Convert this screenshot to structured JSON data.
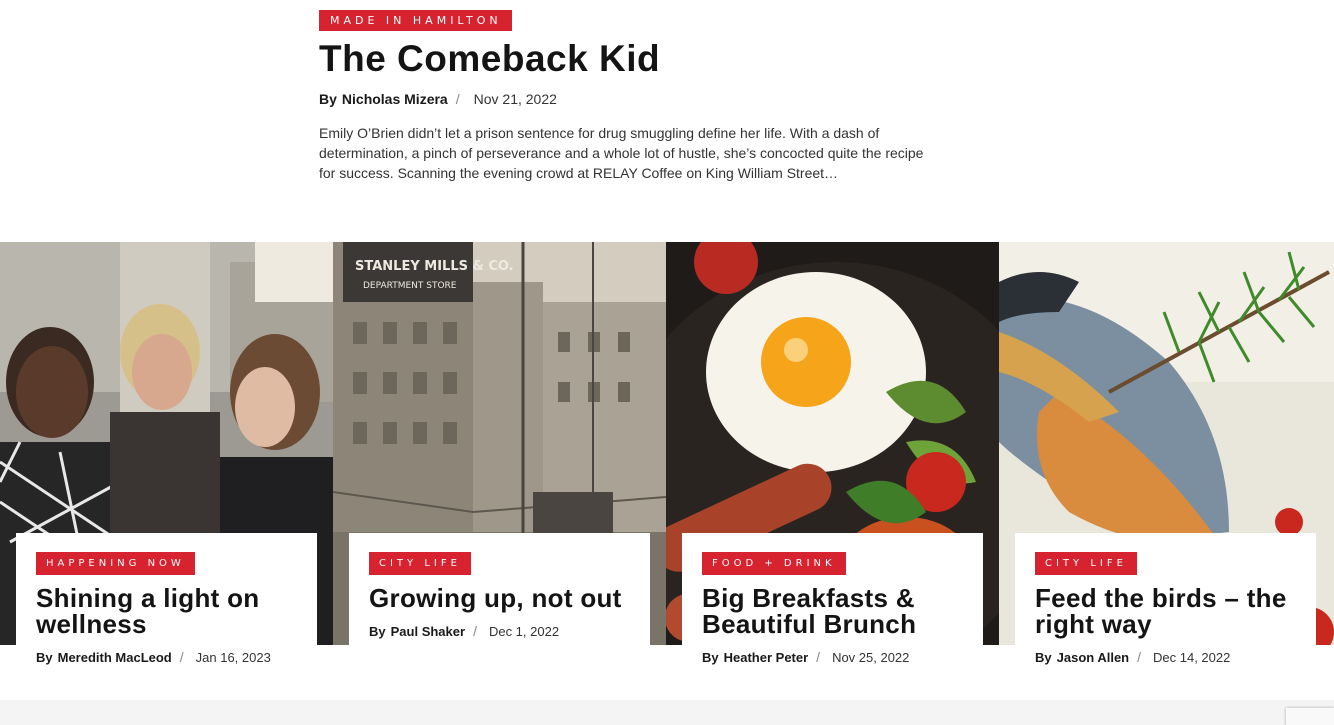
{
  "featured": {
    "tag": "Made in Hamilton",
    "title": "The Comeback Kid",
    "by": "By",
    "author": "Nicholas Mizera",
    "date": "Nov 21, 2022",
    "excerpt": "Emily O’Brien didn’t let a prison sentence for drug smuggling define her life. With a dash of determination, a pinch of perseverance and a whole lot of hustle, she’s concocted quite the recipe for success. Scanning the evening crowd at RELAY Coffee on King William Street…"
  },
  "cards": [
    {
      "tag": "Happening Now",
      "title": "Shining a light on wellness",
      "by": "By",
      "author": "Meredith MacLeod",
      "date": "Jan 16, 2023",
      "image": "photo-women-smiling"
    },
    {
      "tag": "City Life",
      "title": "Growing up, not out",
      "by": "By",
      "author": "Paul Shaker",
      "date": "Dec 1, 2022",
      "image": "photo-historic-street"
    },
    {
      "tag": "Food + Drink",
      "title": "Big Breakfasts & Beautiful Brunch",
      "by": "By",
      "author": "Heather Peter",
      "date": "Nov 25, 2022",
      "image": "photo-breakfast-plate"
    },
    {
      "tag": "City Life",
      "title": "Feed the birds – the right way",
      "by": "By",
      "author": "Jason Allen",
      "date": "Dec 14, 2022",
      "image": "photo-nuthatch-bird"
    }
  ],
  "colors": {
    "accent": "#d7232f"
  }
}
